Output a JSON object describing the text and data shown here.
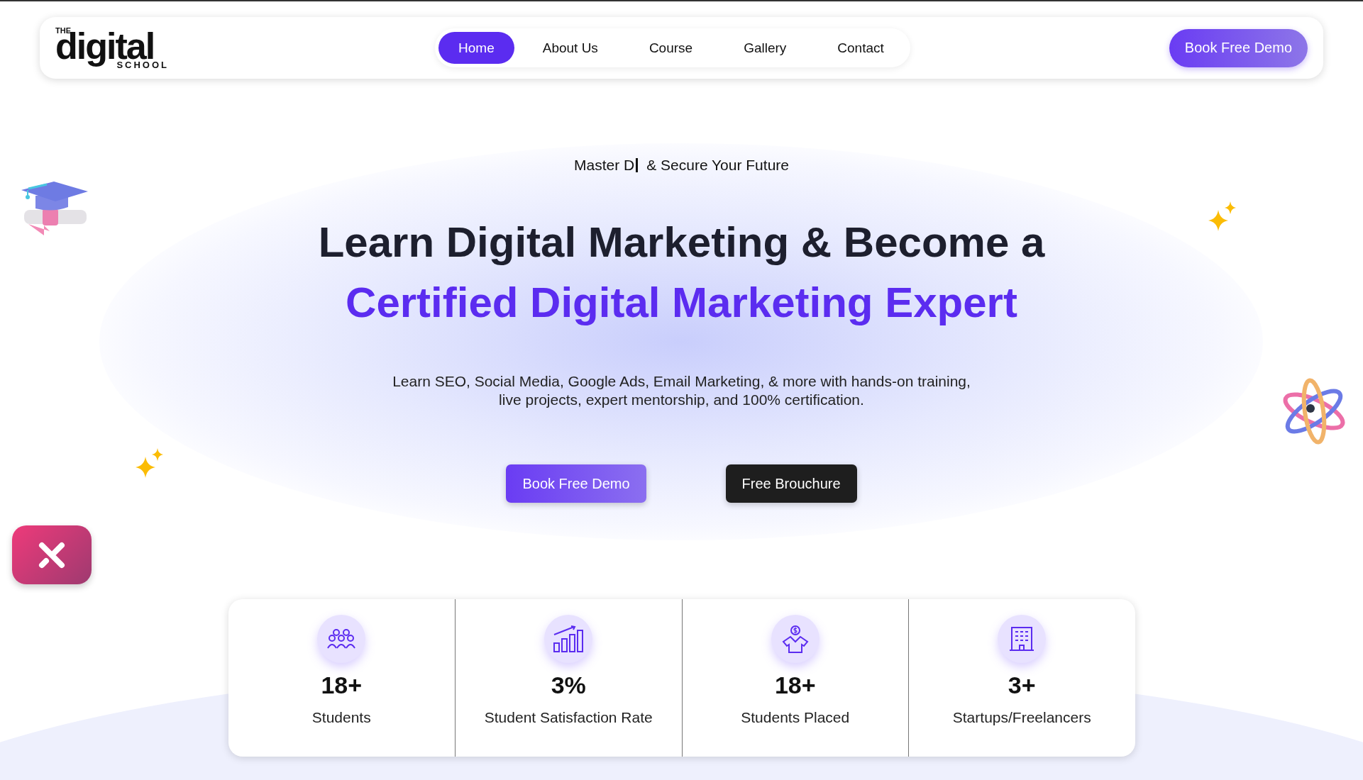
{
  "logo": {
    "top": "THE",
    "word": "digital",
    "bottom": "SCHOOL"
  },
  "nav": [
    {
      "label": "Home",
      "selected": true
    },
    {
      "label": "About Us",
      "selected": false
    },
    {
      "label": "Course",
      "selected": false
    },
    {
      "label": "Gallery",
      "selected": false
    },
    {
      "label": "Contact",
      "selected": false
    }
  ],
  "header_button": "Book Free Demo",
  "hero": {
    "tagline_start": "Master D",
    "tagline_end": "& Secure Your Future",
    "title": "Learn Digital Marketing & Become a",
    "title_highlight": "Certified Digital Marketing Expert",
    "description_line_1": "Learn SEO, Social Media, Google Ads, Email Marketing, & more with hands-on training,",
    "description_line_2": "live projects, expert mentorship, and 100% certification.",
    "buttons": [
      {
        "label": "Book Free Demo",
        "kind": "primary"
      },
      {
        "label": "Free Brouchure",
        "kind": "dark"
      }
    ]
  },
  "stats": [
    {
      "value": "18+",
      "label": "Students",
      "kind": "people"
    },
    {
      "value": "3%",
      "label": "Student Satisfaction Rate",
      "kind": "growth"
    },
    {
      "value": "18+",
      "label": "Students Placed",
      "kind": "placed"
    },
    {
      "value": "3+",
      "label": "Startups/Freelancers",
      "kind": "building"
    }
  ]
}
